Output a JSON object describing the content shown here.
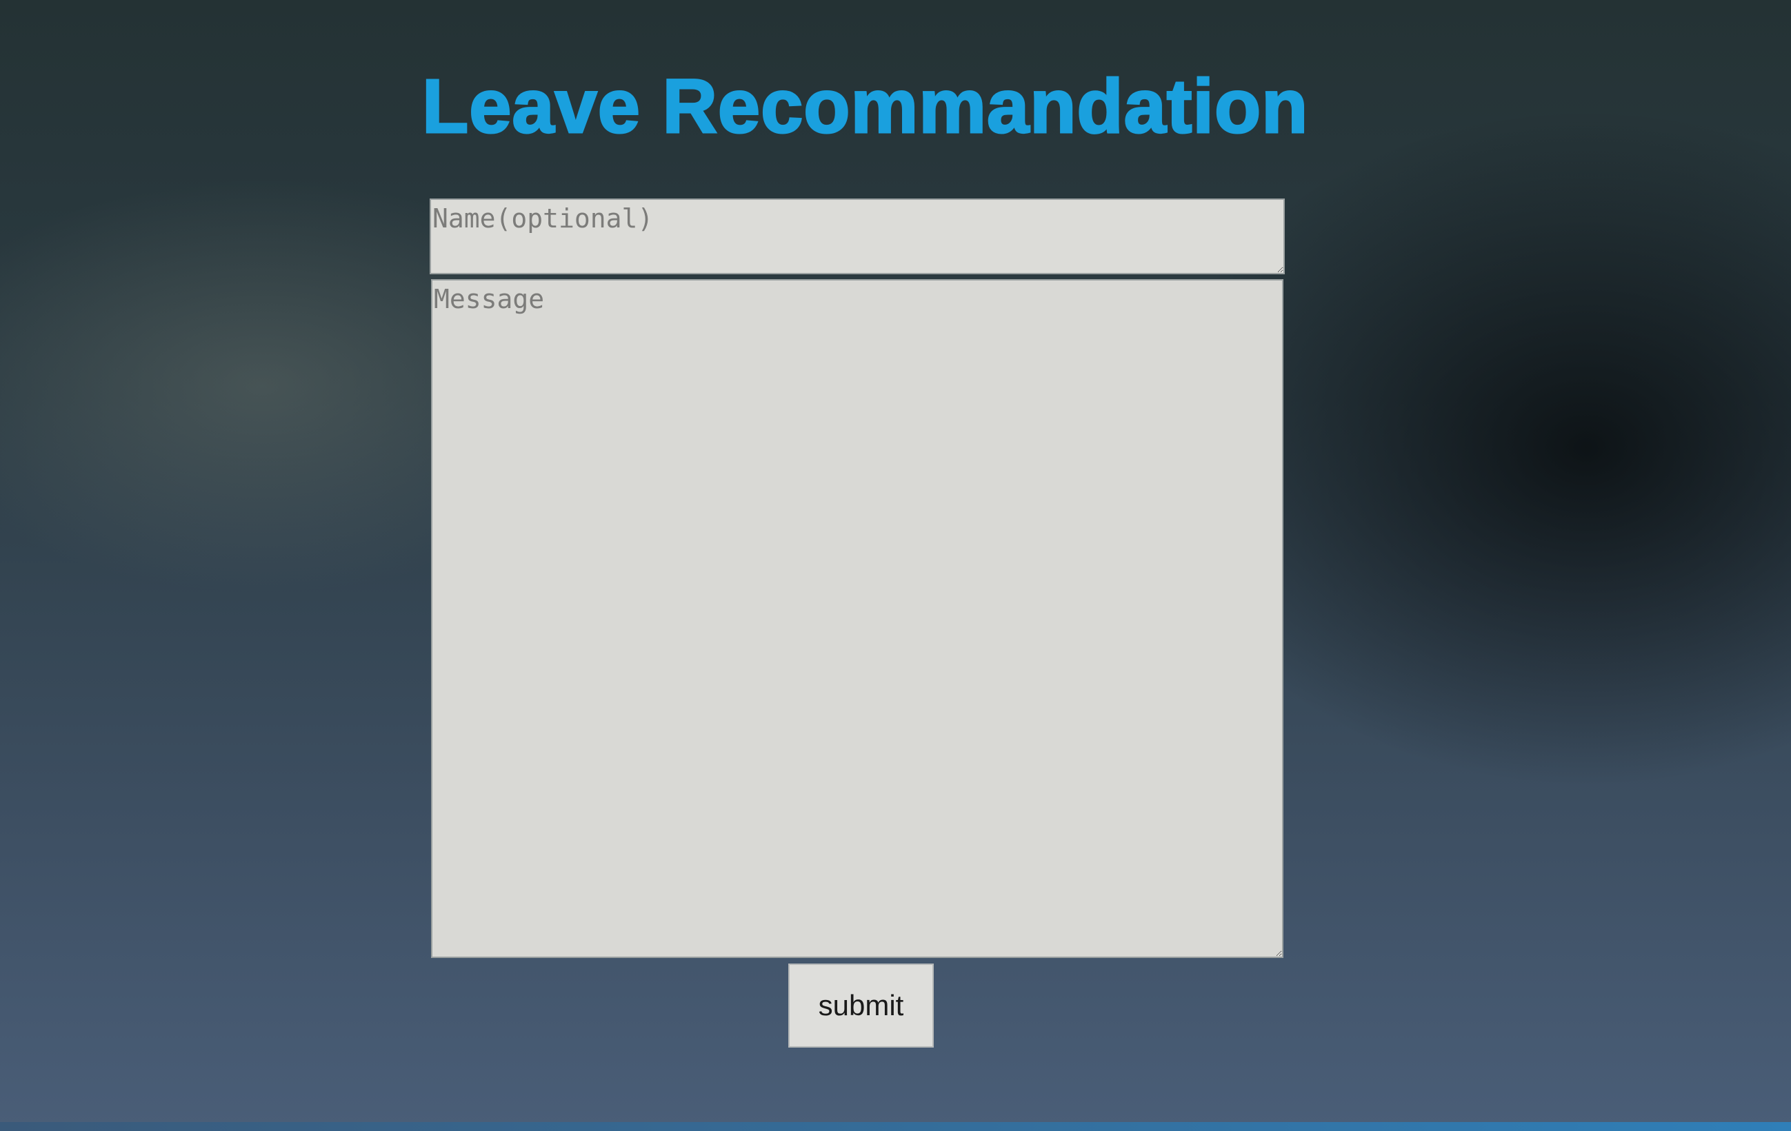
{
  "page": {
    "title": "Leave Recommandation",
    "title_color": "#1aa0de"
  },
  "form": {
    "name_placeholder": "Name(optional)",
    "name_value": "",
    "message_placeholder": "Message",
    "message_value": "",
    "submit_label": "submit"
  }
}
